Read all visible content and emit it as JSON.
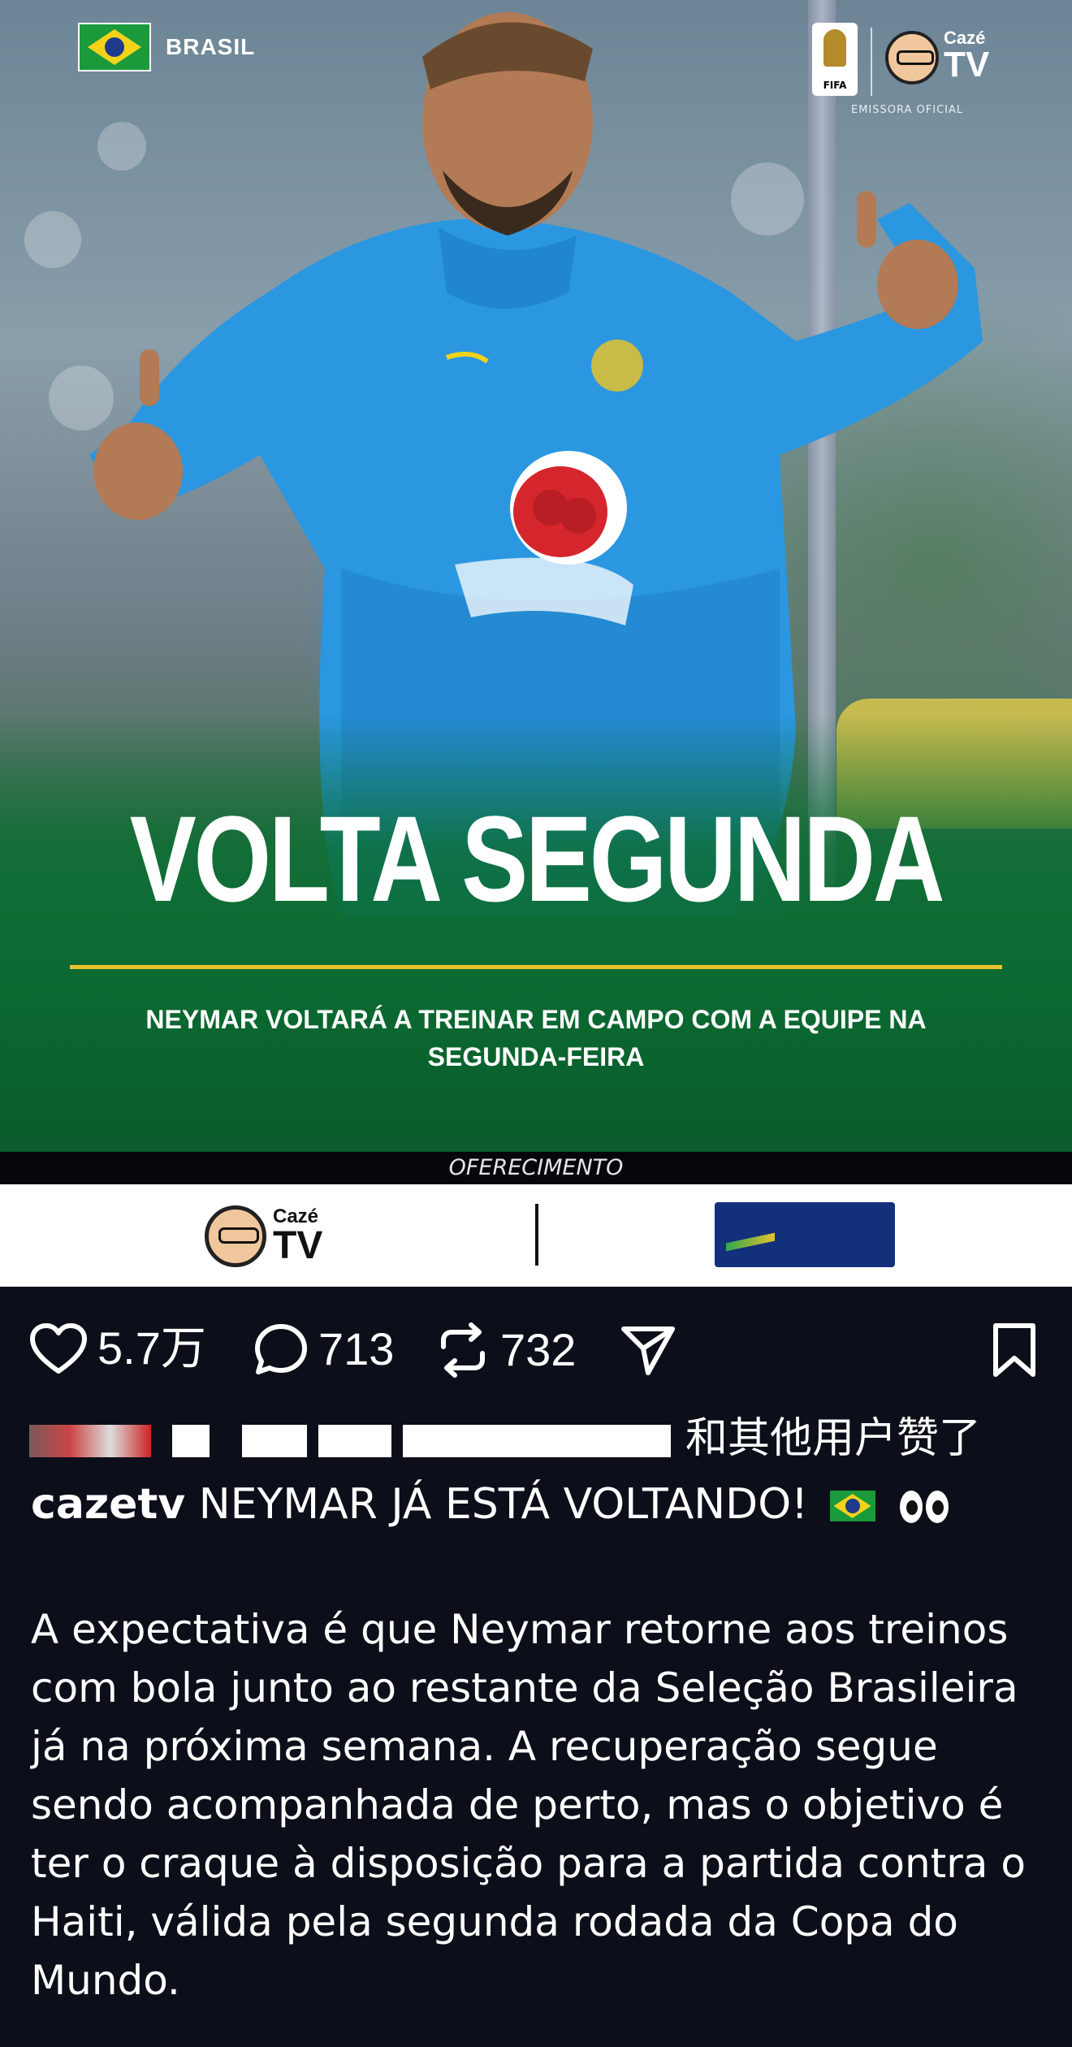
{
  "post": {
    "badge_label": "BRASIL",
    "broadcaster_label": "EMISSORA OFICIAL",
    "fifa_label": "FIFA",
    "caze_small": "Cazé",
    "caze_big": "TV",
    "headline": "VOLTA SEGUNDA",
    "subhead": "NEYMAR VOLTARÁ A TREINAR EM CAMPO COM A EQUIPE NA SEGUNDA-FEIRA",
    "offer_label": "OFERECIMENTO"
  },
  "sponsors": {
    "caze_small": "Cazé",
    "caze_big": "TV"
  },
  "actions": {
    "likes": "5.7万",
    "comments": "713",
    "reposts": "732"
  },
  "liked_by": {
    "suffix": "和其他用户赞了"
  },
  "caption": {
    "username": "cazetv",
    "title": "NEYMAR JÁ ESTÁ VOLTANDO!",
    "body": "A expectativa é que Neymar retorne aos treinos com bola junto ao restante da Seleção Brasileira já na próxima semana. A recuperação segue sendo acompanhada de perto, mas o objetivo é ter o craque à disposição para a partida contra o Haiti, válida pela segunda rodada da Copa do Mundo."
  },
  "colors": {
    "background": "#0c0f19",
    "gold_line": "#e5c12c",
    "brazil_green": "#1a9a3a"
  }
}
